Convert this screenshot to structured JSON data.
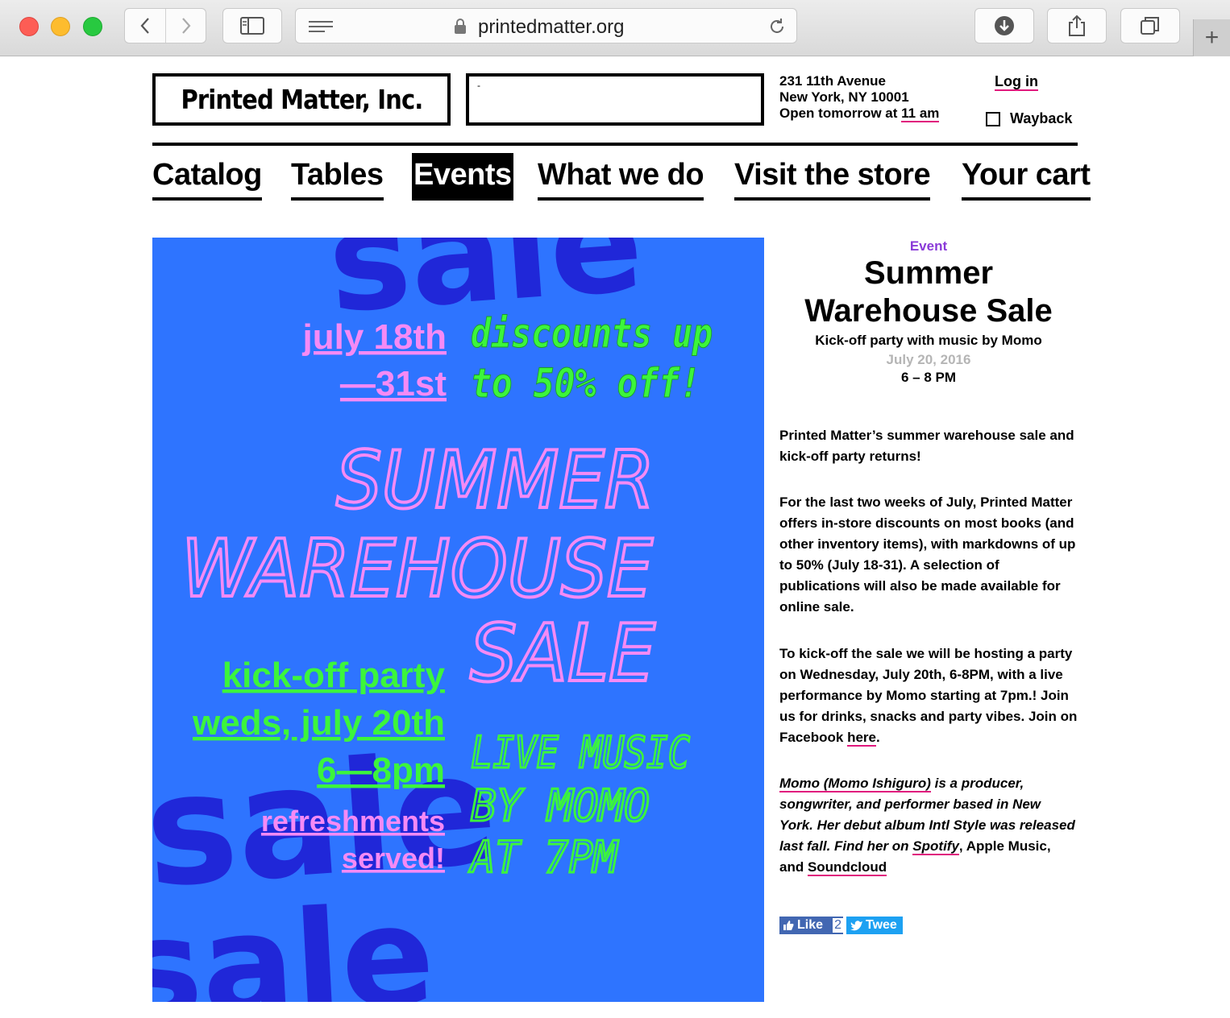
{
  "browser": {
    "url": "printedmatter.org"
  },
  "header": {
    "logo_text": "Printed Matter, Inc.",
    "search_value": "-",
    "address_line1": "231 11th Avenue",
    "address_line2": "New York, NY 10001",
    "hours_prefix": "Open tomorrow at ",
    "hours_time": "11 am",
    "login_label": "Log in",
    "wayback_label": "Wayback"
  },
  "nav": {
    "items": [
      {
        "label": "Catalog"
      },
      {
        "label": "Tables"
      },
      {
        "label": "Events",
        "active": true
      },
      {
        "label": "What we do"
      },
      {
        "label": "Visit the store"
      },
      {
        "label": "Your cart"
      }
    ]
  },
  "poster": {
    "bg_word": "sale",
    "dates_line1": "july 18th",
    "dates_line2": "—31st",
    "discount_line1": "discounts up",
    "discount_line2": "to 50% off!",
    "title_line1": "SUMMER",
    "title_line2": "WAREHOUSE",
    "title_line3": "SALE",
    "party_line1": "kick-off party",
    "party_line2": "weds, july 20th",
    "party_line3": "6—8pm",
    "refresh_line1": "refreshments",
    "refresh_line2": "served!",
    "music_line1": "LIVE MUSIC",
    "music_line2": "BY MOMO",
    "music_line3": "AT 7PM",
    "colors": {
      "bg": "#2e74ff",
      "big_word": "#2027d8",
      "pink": "#f58af5",
      "green": "#3cf53c"
    }
  },
  "event": {
    "kicker": "Event",
    "title": "Summer Warehouse Sale",
    "subtitle": "Kick-off party with music by Momo",
    "date": "July 20, 2016",
    "time": "6 – 8 PM",
    "p1": "Printed Matter’s summer warehouse sale and kick-off party returns!",
    "p2": "For the last two weeks of July, Printed Matter offers in-store discounts on most books (and other inventory items), with markdowns of up to 50% (July 18-31).  A selection of publications will also be made available for online sale.",
    "p3_text": "To kick-off the sale we will be hosting a party on Wednesday, July 20th, 6-8PM, with a live performance by Momo starting at 7pm.! Join us for drinks, snacks and party vibes. Join on Facebook ",
    "p3_link": "here",
    "p3_end": ".",
    "p4_link1": "Momo (Momo Ishiguro)",
    "p4_text1": " is a producer, songwriter, and performer based in New York. Her debut album Intl Style was released last fall. Find her on ",
    "p4_link2": "Spotify",
    "p4_text2": ", Apple Music, and ",
    "p4_link3": "Soundcloud"
  },
  "social": {
    "like_label": "Like",
    "like_count": "2",
    "tweet_label": "Twee"
  }
}
